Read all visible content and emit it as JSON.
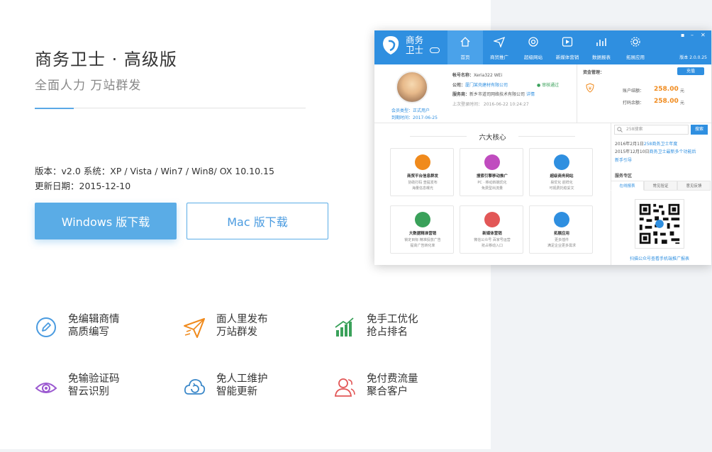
{
  "hero": {
    "title": "商务卫士 · 高级版",
    "subtitle": "全面人力 万站群发"
  },
  "meta": {
    "version_line": "版本：v2.0 系统：XP / Vista / Win7 / Win8/ OX 10.10.15",
    "update_line": "更新日期：2015-12-10"
  },
  "buttons": {
    "windows": "Windows 版下载",
    "mac": "Mac 版下载"
  },
  "features": [
    {
      "icon": "pencil-circle-icon",
      "line1": "免编辑商情",
      "line2": "高质编写",
      "color": "#4a9be0"
    },
    {
      "icon": "paper-plane-icon",
      "line1": "面人里发布",
      "line2": "万站群发",
      "color": "#f08a1c"
    },
    {
      "icon": "rising-bars-icon",
      "line1": "免手工优化",
      "line2": "抢占排名",
      "color": "#3aa15a"
    },
    {
      "icon": "eye-icon",
      "line1": "免输验证码",
      "line2": "智云识别",
      "color": "#9b59d0"
    },
    {
      "icon": "refresh-cloud-icon",
      "line1": "免人工维护",
      "line2": "智能更新",
      "color": "#3b88c9"
    },
    {
      "icon": "user-group-icon",
      "line1": "免付费流量",
      "line2": "聚合客户",
      "color": "#e25757"
    }
  ],
  "app": {
    "logo_line1": "商务",
    "logo_line2": "卫士",
    "nav": [
      "首页",
      "商贸推广",
      "超级网站",
      "新媒体营销",
      "数据报表",
      "拓展应用"
    ],
    "version": "版本 2.0.0.25",
    "account_label": "帐号名称：",
    "account_value": "Xeria322 WEi",
    "company_label": "公司：",
    "company_value": "厦门某壳建材有限公司",
    "audit_status": "审核通过",
    "service_label": "服务商：",
    "service_value": "新乡市道司网络技术有限公司",
    "service_link": "详情",
    "last_login": "上次登录时间：  2016-06-22 10:24:27",
    "member_type_label": "会员类型：",
    "member_type_value": "正式用户",
    "expire_label": "到期时间：",
    "expire_value": "2017-06-25",
    "funds_title": "资金管理：",
    "recharge_label": "充值",
    "balance_label": "账户结额：",
    "balance_value": "258.00",
    "balance_unit": "元",
    "printing_label": "打码余额：",
    "printing_value": "258.00",
    "printing_unit": "元",
    "core_title": "六大核心",
    "core_cards": [
      {
        "icon": "doc-icon",
        "color": "#f08a1c",
        "title": "商贸平台信息群发",
        "d1": "协助打码 查提发布",
        "d2": "海量信息曝光"
      },
      {
        "icon": "promo-icon",
        "color": "#c04cbf",
        "title": "搜索引擎移动推广",
        "d1": "PC · 移动四端优化",
        "d2": "免费型出流量"
      },
      {
        "icon": "monitor-icon",
        "color": "#2f8fe0",
        "title": "超级商务网站",
        "d1": "易优化 前样化",
        "d2": "可视费托稳妥文"
      },
      {
        "icon": "screen-icon",
        "color": "#3aa15a",
        "title": "大数据精准营销",
        "d1": "锁定目标 精准投放广告",
        "d2": "提高广告转化率"
      },
      {
        "icon": "new-media-icon",
        "color": "#e25757",
        "title": "新媒体营销",
        "d1": "微信公众号 百家号运营",
        "d2": "抢占移动入口"
      },
      {
        "icon": "apps-icon",
        "color": "#2f8fe0",
        "title": "拓展应用",
        "d1": "更多插件",
        "d2": "满足企业更多需求"
      }
    ],
    "search_placeholder": "258搜索",
    "search_button": "搜索",
    "news1_date": "2016年2月1日",
    "news1_text": "258商务卫士年度",
    "news2_date": "2015年12月10日",
    "news2_text": "商务卫士最新多个功能后",
    "novice_guide": "新手引导",
    "service_zone": "服务专区",
    "tabs": [
      "在线报表",
      "常见验证",
      "意见反馈"
    ],
    "qr_caption": "扫描公众号查看手机端推广报表"
  },
  "colors": {
    "accent": "#5aace6",
    "app_header": "#2f8fe0",
    "amount": "#f08a1c"
  }
}
